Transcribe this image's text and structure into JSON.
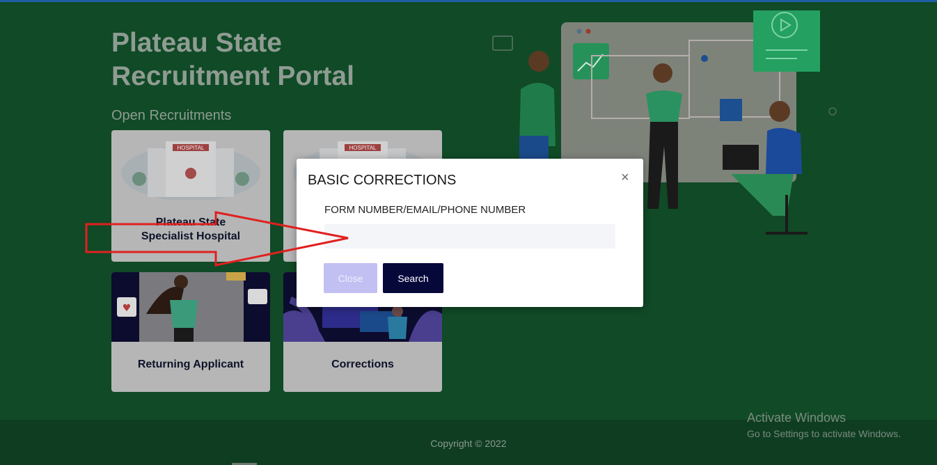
{
  "header": {
    "title_line1": "Plateau State",
    "title_line2": "Recruitment Portal"
  },
  "section": {
    "title": "Open Recruitments"
  },
  "cards": [
    {
      "label_line1": "Plateau State",
      "label_line2": "Specialist Hospital",
      "thumb_sign": "HOSPITAL"
    },
    {
      "label": "",
      "thumb_sign": "HOSPITAL"
    },
    {
      "label": "Returning Applicant"
    },
    {
      "label": "Corrections"
    }
  ],
  "modal": {
    "title": "BASIC CORRECTIONS",
    "close_glyph": "×",
    "field_label": "FORM NUMBER/EMAIL/PHONE NUMBER",
    "field_value": "",
    "close_button": "Close",
    "search_button": "Search"
  },
  "footer": {
    "copyright": "Copyright © 2022"
  },
  "watermark": {
    "line1": "Activate Windows",
    "line2": "Go to Settings to activate Windows."
  },
  "colors": {
    "page_bg": "#104a26",
    "footer_bg": "#0f3d21",
    "search_button": "#07083a",
    "close_button": "#c2c0f2",
    "annotation_arrow": "#e02020"
  }
}
